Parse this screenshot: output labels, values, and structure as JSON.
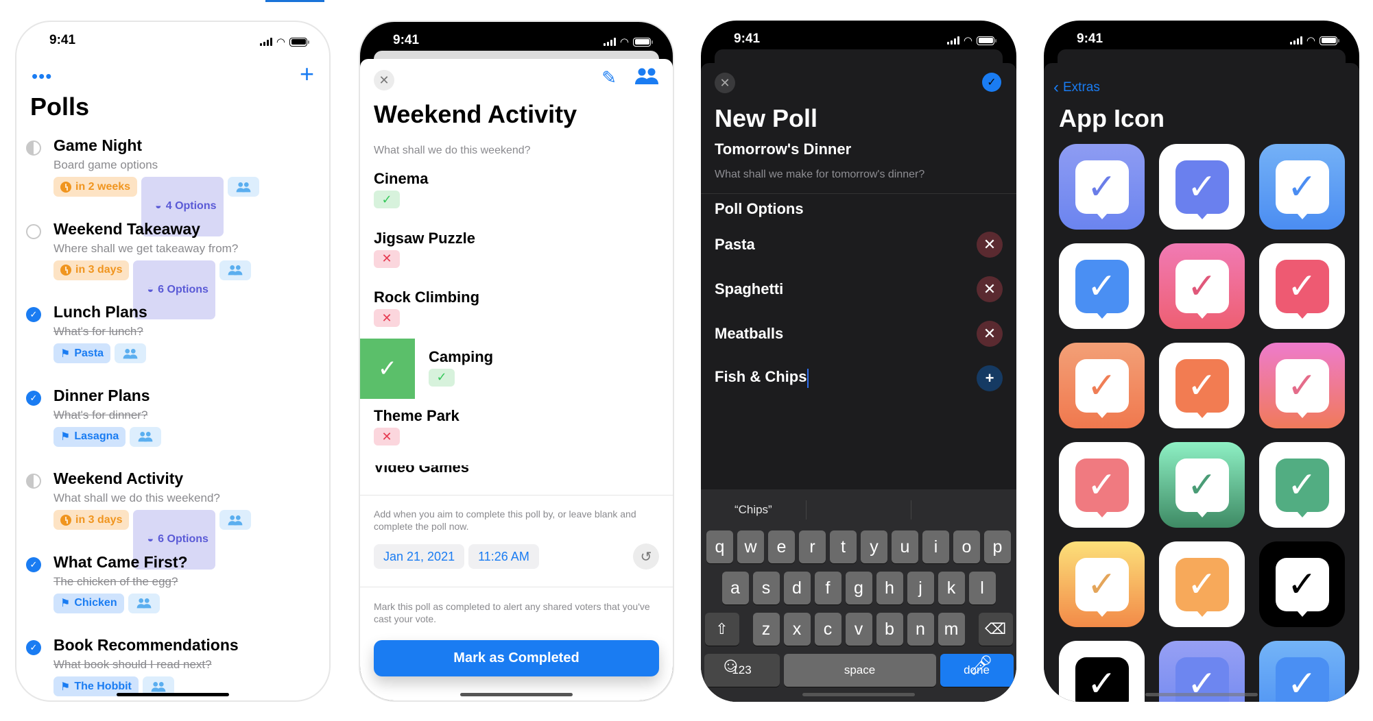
{
  "status_bar": {
    "time": "9:41"
  },
  "polls_screen": {
    "more_label": "•••",
    "add_label": "+",
    "title": "Polls",
    "polls": [
      {
        "title": "Game Night",
        "subtitle": "Board game options",
        "state": "partial",
        "tags": [
          {
            "kind": "due",
            "label": "in 2 weeks"
          },
          {
            "kind": "options",
            "label": "4 Options"
          },
          {
            "kind": "shared",
            "label": ""
          }
        ]
      },
      {
        "title": "Weekend Takeaway",
        "subtitle": "Where shall we get takeaway from?",
        "state": "open",
        "tags": [
          {
            "kind": "due",
            "label": "in 3 days"
          },
          {
            "kind": "options",
            "label": "6 Options"
          },
          {
            "kind": "shared",
            "label": ""
          }
        ]
      },
      {
        "title": "Lunch Plans",
        "subtitle": "What's for lunch?",
        "state": "completed",
        "tags": [
          {
            "kind": "winner",
            "label": "Pasta"
          },
          {
            "kind": "shared",
            "label": ""
          }
        ]
      },
      {
        "title": "Dinner Plans",
        "subtitle": "What's for dinner?",
        "state": "completed",
        "tags": [
          {
            "kind": "winner",
            "label": "Lasagna"
          },
          {
            "kind": "shared",
            "label": ""
          }
        ]
      },
      {
        "title": "Weekend Activity",
        "subtitle": "What shall we do this weekend?",
        "state": "partial",
        "tags": [
          {
            "kind": "due",
            "label": "in 3 days"
          },
          {
            "kind": "options",
            "label": "6 Options"
          },
          {
            "kind": "shared",
            "label": ""
          }
        ]
      },
      {
        "title": "What Came First?",
        "subtitle": "The chicken of the egg?",
        "state": "completed",
        "tags": [
          {
            "kind": "winner",
            "label": "Chicken"
          },
          {
            "kind": "shared",
            "label": ""
          }
        ]
      },
      {
        "title": "Book Recommendations",
        "subtitle": "What book should I read next?",
        "state": "completed",
        "tags": [
          {
            "kind": "winner",
            "label": "The Hobbit"
          },
          {
            "kind": "shared",
            "label": ""
          }
        ]
      }
    ]
  },
  "poll_detail": {
    "title": "Weekend Activity",
    "question": "What shall we do this weekend?",
    "options": [
      {
        "name": "Cinema",
        "vote": "yes"
      },
      {
        "name": "Jigsaw Puzzle",
        "vote": "no"
      },
      {
        "name": "Rock Climbing",
        "vote": "no"
      },
      {
        "name": "Camping",
        "vote": "yes",
        "swiped": true
      },
      {
        "name": "Theme Park",
        "vote": "no"
      },
      {
        "name": "Video Games",
        "vote": "",
        "clipped": true
      }
    ],
    "deadline_help": "Add when you aim to complete this poll by, or leave blank and complete the poll now.",
    "date": "Jan 21, 2021",
    "time": "11:26 AM",
    "complete_help": "Mark this poll as completed to alert any shared voters that you've cast your vote.",
    "complete_button": "Mark as Completed"
  },
  "new_poll": {
    "title": "New Poll",
    "poll_title": "Tomorrow's Dinner",
    "poll_description": "What shall we make for tomorrow's dinner?",
    "options_header": "Poll Options",
    "options": [
      "Pasta",
      "Spaghetti",
      "Meatballs"
    ],
    "new_option_value": "Fish & Chips",
    "keyboard": {
      "suggestions": [
        "“Chips”",
        "",
        ""
      ],
      "row1": [
        "q",
        "w",
        "e",
        "r",
        "t",
        "y",
        "u",
        "i",
        "o",
        "p"
      ],
      "row2": [
        "a",
        "s",
        "d",
        "f",
        "g",
        "h",
        "j",
        "k",
        "l"
      ],
      "row3": [
        "z",
        "x",
        "c",
        "v",
        "b",
        "n",
        "m"
      ],
      "numbers_key": "123",
      "space_key": "space",
      "done_key": "done"
    }
  },
  "app_icon": {
    "back_label": "Extras",
    "title": "App Icon",
    "icons": [
      {
        "name": "indigo",
        "bg": "#6b84ef",
        "bg2": "#8e9cf3",
        "bubble": "#ffffff",
        "check": "#6a7de8"
      },
      {
        "name": "indigo-light",
        "bg": "#ffffff",
        "bg2": "#ffffff",
        "bubble": "#6a80ee",
        "check": "#ffffff"
      },
      {
        "name": "blue",
        "bg": "#4b8df2",
        "bg2": "#74b1f6",
        "bubble": "#ffffff",
        "check": "#4b8df2"
      },
      {
        "name": "blue-light",
        "bg": "#ffffff",
        "bg2": "#ffffff",
        "bubble": "#4a8ff3",
        "check": "#ffffff"
      },
      {
        "name": "pink",
        "bg": "#ee5f72",
        "bg2": "#f17ab4",
        "bubble": "#ffffff",
        "check": "#e0587a"
      },
      {
        "name": "pink-light",
        "bg": "#ffffff",
        "bg2": "#ffffff",
        "bubble": "#ee5a72",
        "check": "#ffffff"
      },
      {
        "name": "orange",
        "bg": "#f0784e",
        "bg2": "#f3a077",
        "bubble": "#ffffff",
        "check": "#ef7e56"
      },
      {
        "name": "orange-light",
        "bg": "#ffffff",
        "bg2": "#ffffff",
        "bubble": "#f27c52",
        "check": "#ffffff"
      },
      {
        "name": "sunset",
        "bg": "#f07a5a",
        "bg2": "#ee7bcc",
        "bubble": "#ffffff",
        "check": "#e46c8a"
      },
      {
        "name": "sunset-light",
        "bg": "#ffffff",
        "bg2": "#ffffff",
        "bubble": "#f07a80",
        "check": "#ffffff"
      },
      {
        "name": "green",
        "bg": "#3e8a64",
        "bg2": "#8ef0c4",
        "bubble": "#ffffff",
        "check": "#4a9c76"
      },
      {
        "name": "green-light",
        "bg": "#ffffff",
        "bg2": "#ffffff",
        "bubble": "#52ad82",
        "check": "#ffffff"
      },
      {
        "name": "yellow",
        "bg": "#f28a48",
        "bg2": "#fce07a",
        "bubble": "#ffffff",
        "check": "#e4a55a"
      },
      {
        "name": "yellow-light",
        "bg": "#ffffff",
        "bg2": "#ffffff",
        "bubble": "#f7a95a",
        "check": "#ffffff"
      },
      {
        "name": "black",
        "bg": "#000000",
        "bg2": "#000000",
        "bubble": "#ffffff",
        "check": "#000000"
      },
      {
        "name": "black-light",
        "bg": "#ffffff",
        "bg2": "#ffffff",
        "bubble": "#000000",
        "check": "#ffffff"
      },
      {
        "name": "indigo-bright",
        "bg": "#6d86f0",
        "bg2": "#97a0f4",
        "bubble": "#6d86f0",
        "check": "#ffffff"
      },
      {
        "name": "blue-bright",
        "bg": "#4a8ff3",
        "bg2": "#74b4f7",
        "bubble": "#4a8ff3",
        "check": "#ffffff"
      }
    ]
  },
  "colors": {
    "accent": "#1a7cf2",
    "yes": "#34c759",
    "no": "#e63950"
  }
}
